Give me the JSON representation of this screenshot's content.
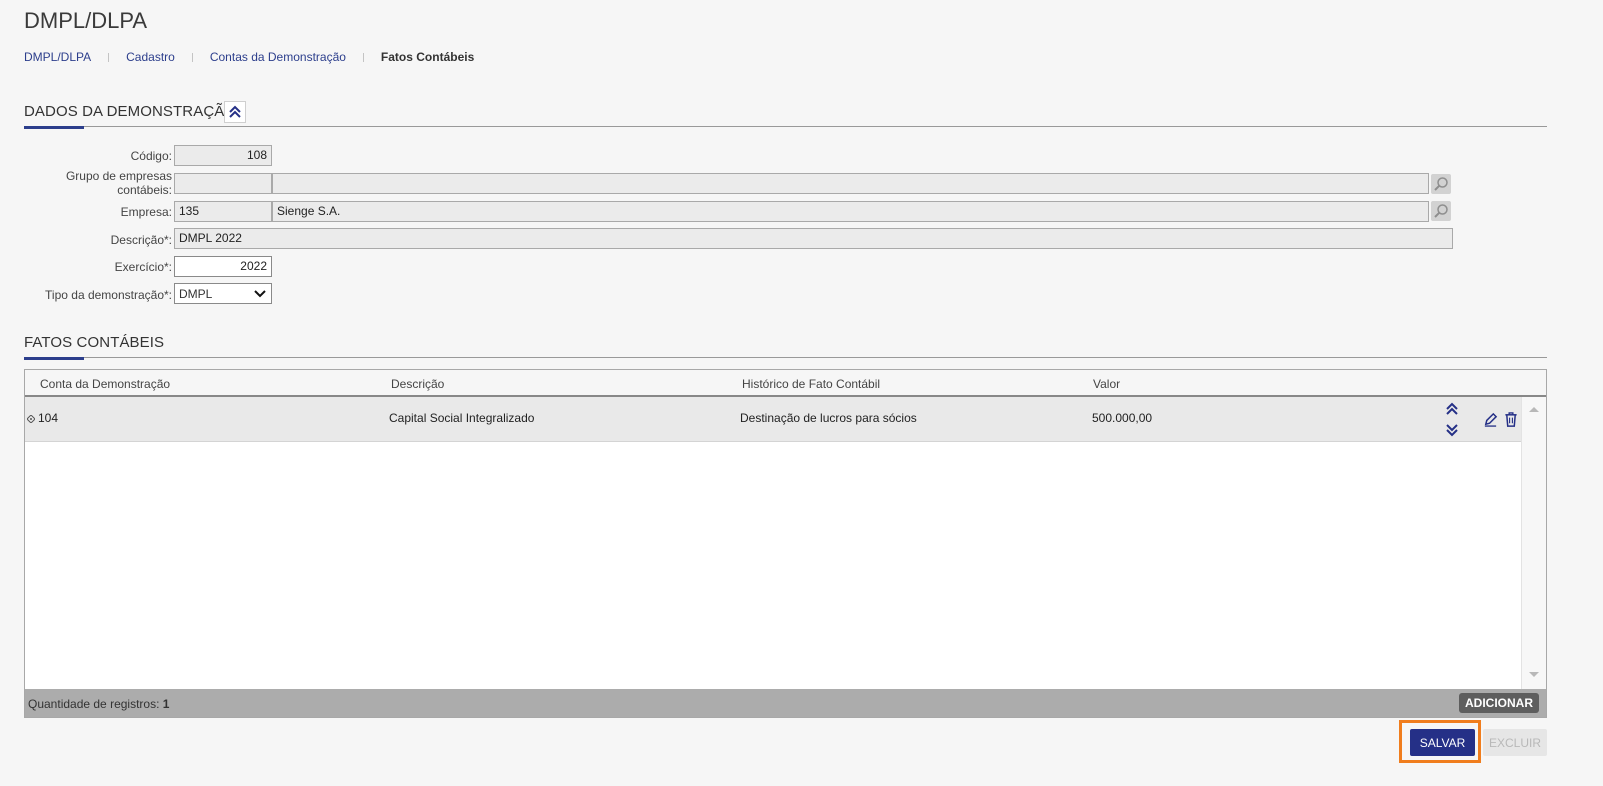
{
  "page": {
    "title": "DMPL/DLPA"
  },
  "breadcrumb": [
    "DMPL/DLPA",
    "Cadastro",
    "Contas da Demonstração",
    "Fatos Contábeis"
  ],
  "section_dados": {
    "title": "DADOS DA DEMONSTRAÇÃO",
    "collapse_icon": "double-chevron-up-icon"
  },
  "form": {
    "codigo": {
      "label": "Código:",
      "value": "108"
    },
    "grupo": {
      "label_line1": "Grupo de empresas",
      "label_line2": "contábeis:",
      "code": "",
      "name": ""
    },
    "empresa": {
      "label": "Empresa:",
      "code": "135",
      "name": "Sienge S.A."
    },
    "descricao": {
      "label": "Descrição*:",
      "value": "DMPL 2022"
    },
    "exercicio": {
      "label": "Exercício*:",
      "value": "2022"
    },
    "tipo": {
      "label": "Tipo da demonstração*:",
      "value": "DMPL"
    }
  },
  "section_fatos": {
    "title": "FATOS CONTÁBEIS"
  },
  "grid": {
    "columns": [
      "Conta da Demonstração",
      "Descrição",
      "Histórico de Fato Contábil",
      "Valor"
    ],
    "rows": [
      {
        "conta": "104",
        "descricao": "Capital Social Integralizado",
        "historico": "Destinação de lucros para sócios",
        "valor": "500.000,00"
      }
    ],
    "footer_label": "Quantidade de registros:",
    "footer_count": "1",
    "add_label": "ADICIONAR"
  },
  "actions": {
    "save_label": "SALVAR",
    "delete_label": "EXCLUIR"
  },
  "colors": {
    "accent": "#2c3e8c",
    "primary_button": "#253087",
    "highlight": "#f07d1d"
  }
}
